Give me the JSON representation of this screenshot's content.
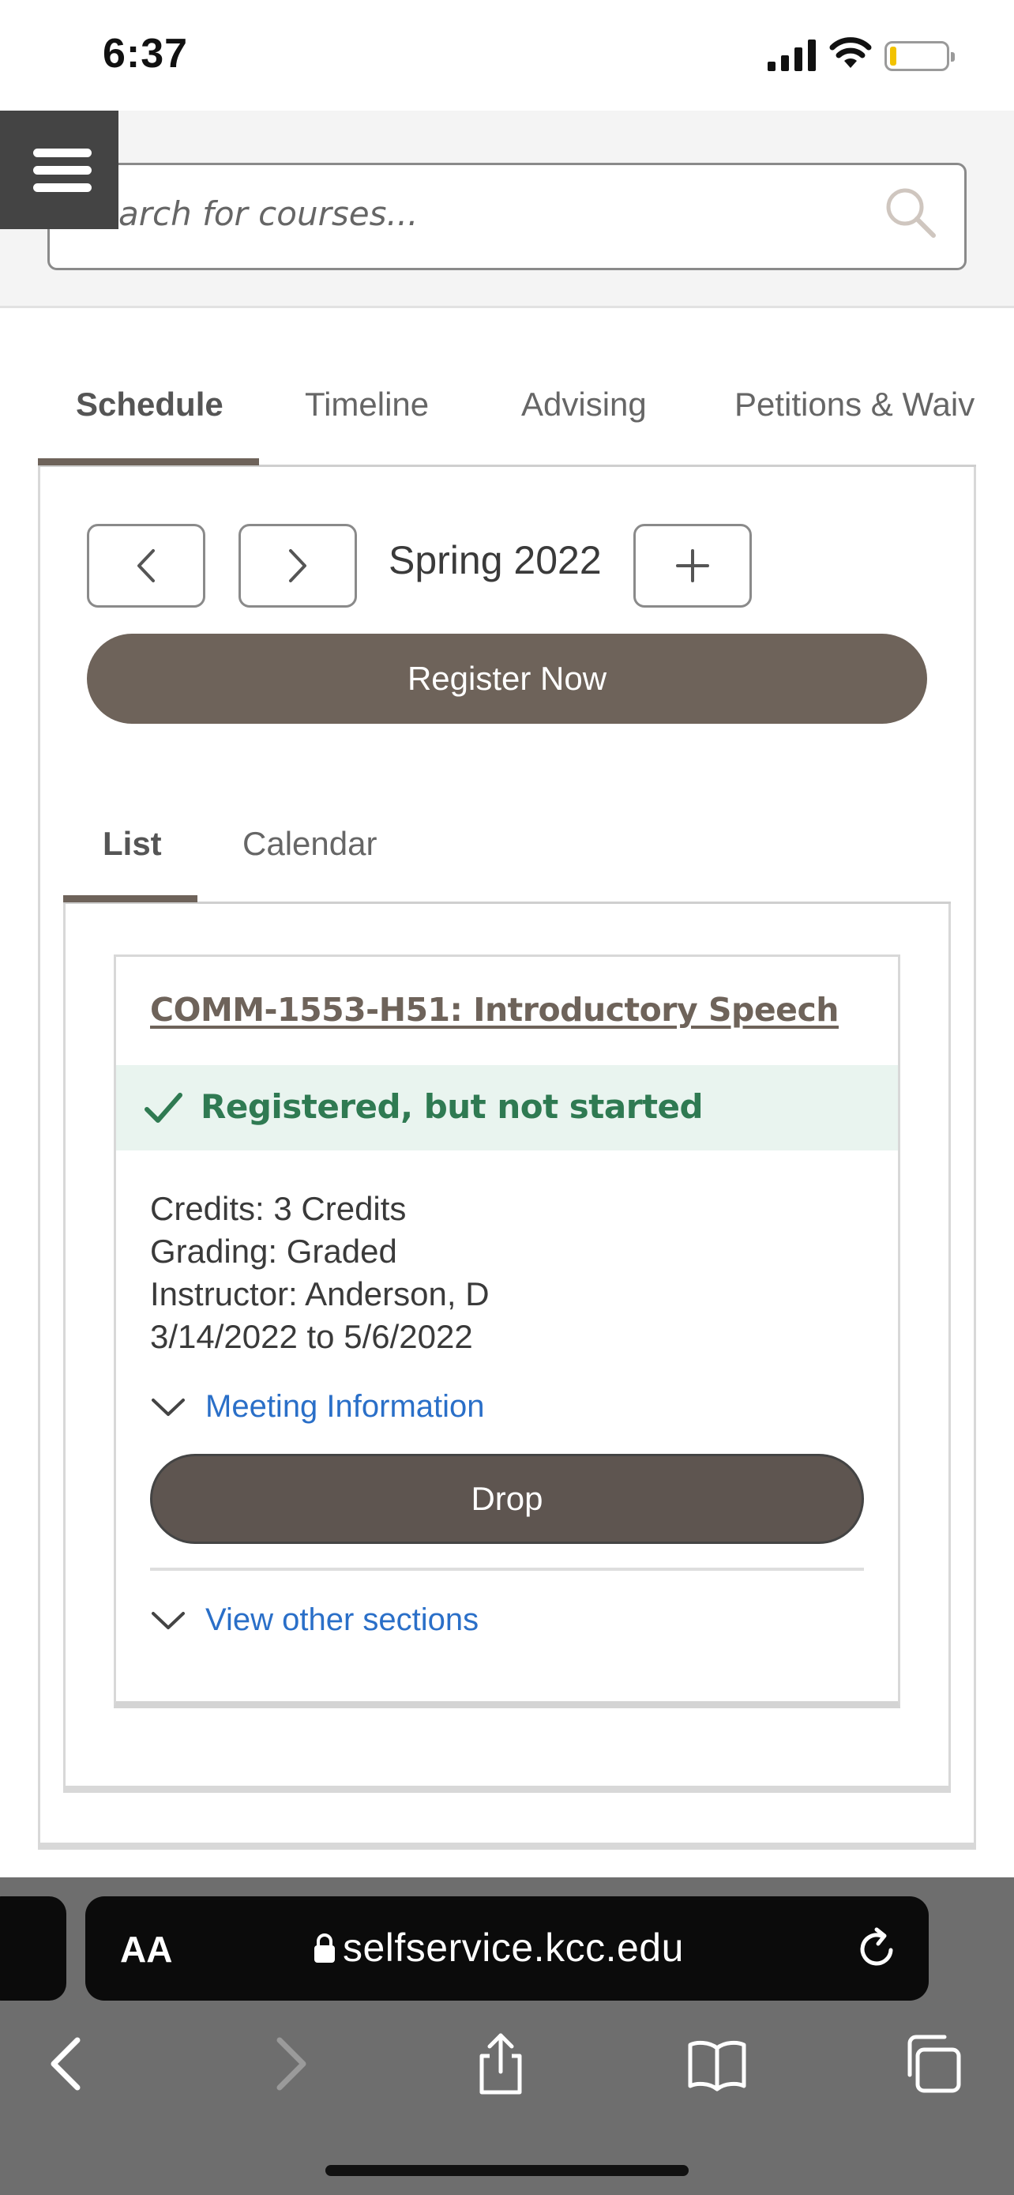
{
  "status_bar": {
    "time": "6:37"
  },
  "header": {
    "search_placeholder": "arch for courses..."
  },
  "main_tabs": [
    {
      "label": "Schedule",
      "active": true
    },
    {
      "label": "Timeline",
      "active": false
    },
    {
      "label": "Advising",
      "active": false
    },
    {
      "label": "Petitions & Waiv",
      "active": false
    }
  ],
  "schedule": {
    "term": "Spring 2022",
    "register_label": "Register Now",
    "sub_tabs": [
      {
        "label": "List",
        "active": true
      },
      {
        "label": "Calendar",
        "active": false
      }
    ],
    "course": {
      "title": "COMM-1553-H51: Introductory Speech",
      "status": "Registered, but not started",
      "credits": "Credits: 3 Credits",
      "grading": "Grading: Graded",
      "instructor": "Instructor: Anderson, D",
      "dates": "3/14/2022 to 5/6/2022",
      "meeting_link": "Meeting Information",
      "drop_label": "Drop",
      "sections_link": "View other sections"
    }
  },
  "browser": {
    "aa_label": "AA",
    "url": "selfservice.kcc.edu"
  },
  "colors": {
    "brand": "#6e635a",
    "status_green": "#2f7a52",
    "status_bg": "#e9f4ef",
    "link_blue": "#2a6fc8"
  }
}
